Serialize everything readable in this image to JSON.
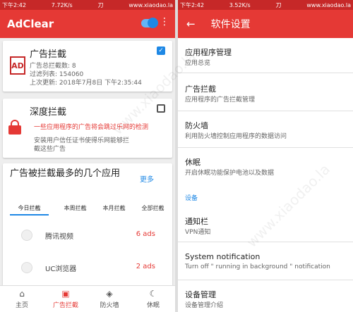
{
  "left": {
    "status": {
      "time": "下午2:42",
      "net": "7.72K/s",
      "extra": "刀",
      "url": "www.xiaodao.la"
    },
    "appbar": {
      "title": "AdClear"
    },
    "card1": {
      "icon_text": "AD",
      "title": "广告拦截",
      "line1": "广告总拦截数: 8",
      "line2": "过滤列表: 154060",
      "line3": "上次更新: 2018年7月8日 下午2:35:44"
    },
    "card2": {
      "title": "深度拦截",
      "warning": "一些应用程序的广告将会跳过乐网的检测",
      "desc1": "安装用户信任证书使得乐网能够拦",
      "desc2": "截这些广告"
    },
    "card3": {
      "title": "广告被拦截最多的几个应用",
      "more": "更多",
      "tabs": [
        "今日拦截",
        "本周拦截",
        "本月拦截",
        "全部拦截"
      ],
      "apps": [
        {
          "name": "腾讯视频",
          "count": "6 ads"
        },
        {
          "name": "UC浏览器",
          "count": "2 ads"
        }
      ]
    },
    "nav": [
      {
        "label": "主页",
        "icon": "home-icon"
      },
      {
        "label": "广告拦截",
        "icon": "ad-icon"
      },
      {
        "label": "防火墙",
        "icon": "shield-icon"
      },
      {
        "label": "休眠",
        "icon": "moon-icon"
      }
    ]
  },
  "right": {
    "status": {
      "time": "下午2:42",
      "net": "3.52K/s",
      "extra": "刀",
      "url": "www.xiaodao.la"
    },
    "appbar": {
      "title": "软件设置"
    },
    "settings": [
      {
        "title": "应用程序管理",
        "sub": "应用总览"
      },
      {
        "title": "广告拦截",
        "sub": "应用程序的广告拦截管理"
      },
      {
        "title": "防火墙",
        "sub": "利用防火墙控制应用程序的数据访问"
      },
      {
        "title": "休眠",
        "sub": "开启休眠功能保护电池以及数据"
      }
    ],
    "section": "设备",
    "settings2": [
      {
        "title": "通知栏",
        "sub": "VPN通知"
      },
      {
        "title": "System notification",
        "sub": "Turn off \" running in background \" notification"
      },
      {
        "title": "设备管理",
        "sub": "设备管理介绍"
      }
    ]
  },
  "watermark": "www.xiaodao.la",
  "colors": {
    "accent": "#e53935",
    "blue": "#1e88e5"
  }
}
